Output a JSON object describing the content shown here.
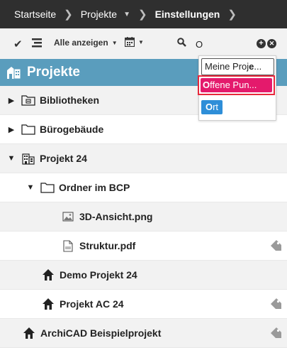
{
  "breadcrumb": {
    "items": [
      "Startseite",
      "Projekte",
      "Einstellungen"
    ]
  },
  "toolbar": {
    "filter_label": "Alle anzeigen",
    "search_value": "O"
  },
  "header": {
    "title": "Projekte"
  },
  "dropdown": {
    "options": [
      {
        "prefix": "Meine Proj",
        "match": "e",
        "suffix": "..."
      },
      {
        "prefix": "",
        "match": "O",
        "suffix": "ffene Pun..."
      },
      {
        "prefix": "",
        "match": "O",
        "suffix": "rt"
      }
    ]
  },
  "tree": {
    "rows": [
      {
        "label": "Bibliotheken"
      },
      {
        "label": "Bürogebäude"
      },
      {
        "label": "Projekt 24"
      },
      {
        "label": "Ordner im BCP"
      },
      {
        "label": "3D-Ansicht.png"
      },
      {
        "label": "Struktur.pdf"
      },
      {
        "label": "Demo Projekt 24"
      },
      {
        "label": "Projekt AC 24"
      },
      {
        "label": "ArchiCAD Beispielprojekt"
      }
    ]
  },
  "colors": {
    "header_bg": "#5a9dbd",
    "crumb_bg": "#2f2f2f",
    "selected_option": "#e41a6c",
    "option_blue": "#2e8ed8",
    "highlight_border": "#e8283c"
  }
}
